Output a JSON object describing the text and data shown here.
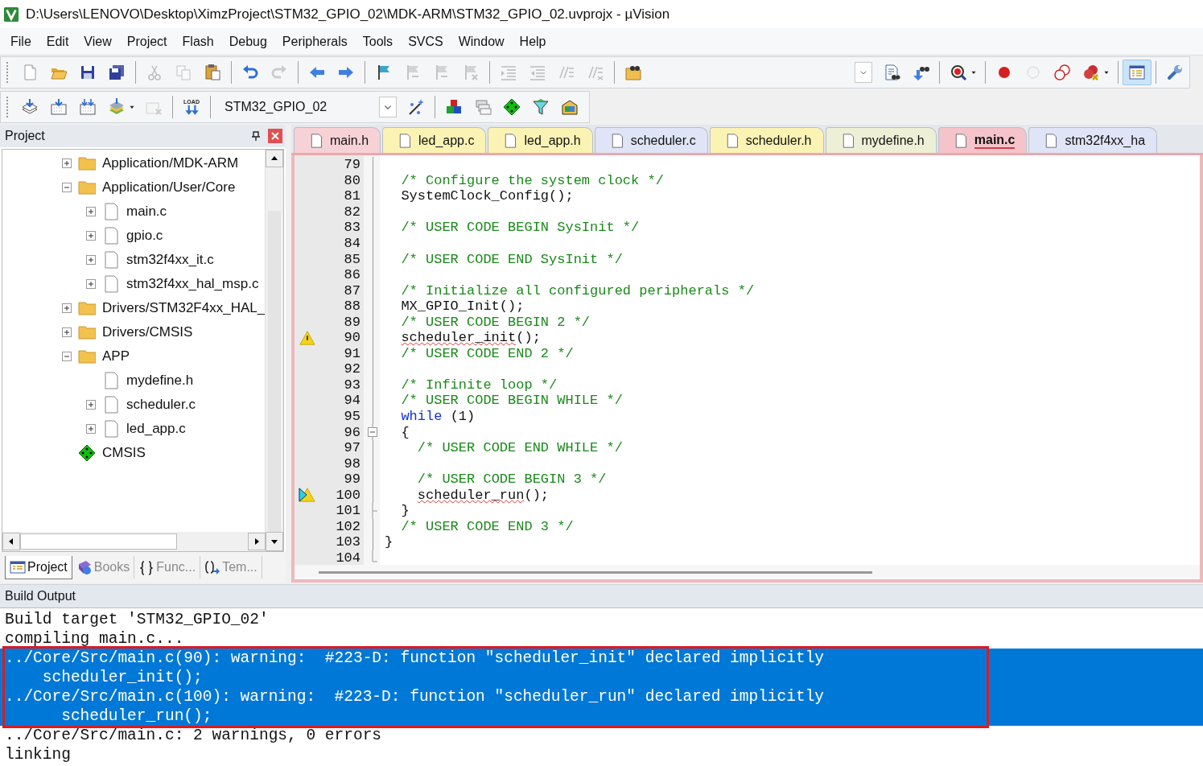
{
  "window": {
    "title": "D:\\Users\\LENOVO\\Desktop\\XimzProject\\STM32_GPIO_02\\MDK-ARM\\STM32_GPIO_02.uvprojx - µVision"
  },
  "menu": [
    "File",
    "Edit",
    "View",
    "Project",
    "Flash",
    "Debug",
    "Peripherals",
    "Tools",
    "SVCS",
    "Window",
    "Help"
  ],
  "toolbar_1": [
    {
      "kind": "new",
      "disabled": false,
      "pressed": false
    },
    {
      "kind": "open",
      "disabled": false,
      "pressed": false
    },
    {
      "kind": "save",
      "disabled": false,
      "pressed": false
    },
    {
      "kind": "save-all",
      "disabled": false,
      "pressed": false
    },
    {
      "kind": "separator"
    },
    {
      "kind": "cut",
      "disabled": true,
      "pressed": false
    },
    {
      "kind": "copy",
      "disabled": true,
      "pressed": false
    },
    {
      "kind": "paste",
      "disabled": false,
      "pressed": false
    },
    {
      "kind": "separator"
    },
    {
      "kind": "undo",
      "disabled": false,
      "pressed": false
    },
    {
      "kind": "redo",
      "disabled": true,
      "pressed": false
    },
    {
      "kind": "separator"
    },
    {
      "kind": "back",
      "disabled": false,
      "pressed": false
    },
    {
      "kind": "forward",
      "disabled": false,
      "pressed": false
    },
    {
      "kind": "separator"
    },
    {
      "kind": "bookmark",
      "disabled": false,
      "pressed": false
    },
    {
      "kind": "bookmark-prev",
      "disabled": true,
      "pressed": false
    },
    {
      "kind": "bookmark-next",
      "disabled": true,
      "pressed": false
    },
    {
      "kind": "bookmark-clear",
      "disabled": true,
      "pressed": false
    },
    {
      "kind": "separator"
    },
    {
      "kind": "indent",
      "disabled": true,
      "pressed": false
    },
    {
      "kind": "unindent",
      "disabled": true,
      "pressed": false
    },
    {
      "kind": "comment",
      "disabled": true,
      "pressed": false
    },
    {
      "kind": "uncomment",
      "disabled": true,
      "pressed": false
    },
    {
      "kind": "separator"
    },
    {
      "kind": "find-in-files",
      "disabled": false,
      "pressed": false
    },
    {
      "kind": "spacer"
    },
    {
      "kind": "find-combo"
    },
    {
      "kind": "find",
      "disabled": false,
      "pressed": false
    },
    {
      "kind": "incremental-find",
      "disabled": false,
      "pressed": false
    },
    {
      "kind": "separator"
    },
    {
      "kind": "debug",
      "disabled": false,
      "pressed": false
    },
    {
      "kind": "caret",
      "disabled": false,
      "pressed": false
    },
    {
      "kind": "separator"
    },
    {
      "kind": "breakpoint",
      "disabled": false,
      "pressed": false
    },
    {
      "kind": "breakpoint-disable",
      "disabled": true,
      "pressed": false
    },
    {
      "kind": "breakpoint-kill",
      "disabled": false,
      "pressed": false
    },
    {
      "kind": "breakpoint-kill-all",
      "disabled": false,
      "pressed": false
    },
    {
      "kind": "caret",
      "disabled": false,
      "pressed": false
    },
    {
      "kind": "separator"
    },
    {
      "kind": "window-layout",
      "disabled": false,
      "pressed": true
    },
    {
      "kind": "separator"
    },
    {
      "kind": "configure",
      "disabled": false,
      "pressed": false
    }
  ],
  "toolbar_2": [
    {
      "kind": "translate",
      "disabled": false,
      "pressed": false
    },
    {
      "kind": "build",
      "disabled": false,
      "pressed": false
    },
    {
      "kind": "rebuild",
      "disabled": false,
      "pressed": false
    },
    {
      "kind": "batch-build",
      "disabled": false,
      "pressed": false
    },
    {
      "kind": "caret",
      "disabled": false,
      "pressed": false
    },
    {
      "kind": "stop-build",
      "disabled": true,
      "pressed": false
    },
    {
      "kind": "separator"
    },
    {
      "kind": "load",
      "disabled": false,
      "pressed": false,
      "label": "LOAD"
    },
    {
      "kind": "separator"
    },
    {
      "kind": "target",
      "value": "STM32_GPIO_02"
    },
    {
      "kind": "options",
      "disabled": false,
      "pressed": false
    },
    {
      "kind": "separator"
    },
    {
      "kind": "manage",
      "disabled": false,
      "pressed": false
    },
    {
      "kind": "multi-project",
      "disabled": false,
      "pressed": false
    },
    {
      "kind": "run-time",
      "disabled": false,
      "pressed": false
    },
    {
      "kind": "select-packs",
      "disabled": false,
      "pressed": false
    },
    {
      "kind": "pack-installer",
      "disabled": false,
      "pressed": false
    }
  ],
  "project_panel": {
    "title": "Project",
    "tree": [
      {
        "label": "Application/MDK-ARM",
        "kind": "folder",
        "expanded": false
      },
      {
        "label": "Application/User/Core",
        "kind": "folder",
        "expanded": true,
        "children": [
          {
            "label": "main.c",
            "kind": "file",
            "expanded": false
          },
          {
            "label": "gpio.c",
            "kind": "file",
            "expanded": false
          },
          {
            "label": "stm32f4xx_it.c",
            "kind": "file",
            "expanded": false
          },
          {
            "label": "stm32f4xx_hal_msp.c",
            "kind": "file",
            "expanded": false
          }
        ]
      },
      {
        "label": "Drivers/STM32F4xx_HAL_",
        "kind": "folder",
        "expanded": false
      },
      {
        "label": "Drivers/CMSIS",
        "kind": "folder",
        "expanded": false
      },
      {
        "label": "APP",
        "kind": "folder",
        "expanded": true,
        "children": [
          {
            "label": "mydefine.h",
            "kind": "file"
          },
          {
            "label": "scheduler.c",
            "kind": "file",
            "expanded": false
          },
          {
            "label": "led_app.c",
            "kind": "file",
            "expanded": false
          }
        ]
      },
      {
        "label": "CMSIS",
        "kind": "component"
      }
    ],
    "tabs": [
      {
        "label": "Project",
        "kind": "project",
        "selected": true
      },
      {
        "label": "Books",
        "kind": "books",
        "selected": false
      },
      {
        "label": "Func...",
        "kind": "functions",
        "selected": false
      },
      {
        "label": "Tem...",
        "kind": "templates",
        "selected": false
      }
    ]
  },
  "editor": {
    "tabs": [
      {
        "label": "main.h",
        "color": "#f6d2d6",
        "selected": false
      },
      {
        "label": "led_app.c",
        "color": "#fbf3b4",
        "selected": false
      },
      {
        "label": "led_app.h",
        "color": "#fbf3b4",
        "selected": false
      },
      {
        "label": "scheduler.c",
        "color": "#dfe4f6",
        "selected": false
      },
      {
        "label": "scheduler.h",
        "color": "#fbf3b4",
        "selected": false
      },
      {
        "label": "mydefine.h",
        "color": "#eef0d6",
        "selected": false
      },
      {
        "label": "main.c",
        "color": "#f5c4ca",
        "selected": true
      },
      {
        "label": "stm32f4xx_ha",
        "color": "#dfe4f6",
        "selected": false
      }
    ],
    "lines": [
      {
        "number": "79",
        "kind": "line",
        "warning": false,
        "current": false
      },
      {
        "number": "80",
        "kind": "line",
        "warning": false,
        "current": false,
        "code": [
          {
            "kind": "comment",
            "text": "  /* Configure the system clock */"
          }
        ]
      },
      {
        "number": "81",
        "kind": "line",
        "warning": false,
        "current": false,
        "code": [
          {
            "kind": "plain",
            "text": "  SystemClock_Config();"
          }
        ]
      },
      {
        "number": "82",
        "kind": "line",
        "warning": false,
        "current": false
      },
      {
        "number": "83",
        "kind": "line",
        "warning": false,
        "current": false,
        "code": [
          {
            "kind": "comment",
            "text": "  /* USER CODE BEGIN SysInit */"
          }
        ]
      },
      {
        "number": "84",
        "kind": "line",
        "warning": false,
        "current": false
      },
      {
        "number": "85",
        "kind": "line",
        "warning": false,
        "current": false,
        "code": [
          {
            "kind": "comment",
            "text": "  /* USER CODE END SysInit */"
          }
        ]
      },
      {
        "number": "86",
        "kind": "line",
        "warning": false,
        "current": false
      },
      {
        "number": "87",
        "kind": "line",
        "warning": false,
        "current": false,
        "code": [
          {
            "kind": "comment",
            "text": "  /* Initialize all configured peripherals */"
          }
        ]
      },
      {
        "number": "88",
        "kind": "line",
        "warning": false,
        "current": false,
        "code": [
          {
            "kind": "plain",
            "text": "  MX_GPIO_Init();"
          }
        ]
      },
      {
        "number": "89",
        "kind": "line",
        "warning": false,
        "current": false,
        "code": [
          {
            "kind": "comment",
            "text": "  /* USER CODE BEGIN 2 */"
          }
        ]
      },
      {
        "number": "90",
        "kind": "line",
        "warning": true,
        "current": false,
        "code": [
          {
            "kind": "squiggle",
            "text": "  scheduler_init"
          },
          {
            "kind": "plain",
            "text": "();"
          }
        ]
      },
      {
        "number": "91",
        "kind": "line",
        "warning": false,
        "current": false,
        "code": [
          {
            "kind": "comment",
            "text": "  /* USER CODE END 2 */"
          }
        ]
      },
      {
        "number": "92",
        "kind": "line",
        "warning": false,
        "current": false
      },
      {
        "number": "93",
        "kind": "line",
        "warning": false,
        "current": false,
        "code": [
          {
            "kind": "comment",
            "text": "  /* Infinite loop */"
          }
        ]
      },
      {
        "number": "94",
        "kind": "line",
        "warning": false,
        "current": false,
        "code": [
          {
            "kind": "comment",
            "text": "  /* USER CODE BEGIN WHILE */"
          }
        ]
      },
      {
        "number": "95",
        "kind": "line",
        "warning": false,
        "current": false,
        "code": [
          {
            "kind": "keyword",
            "text": "  while"
          },
          {
            "kind": "plain",
            "text": " (1)"
          }
        ]
      },
      {
        "number": "96",
        "kind": "fold-start",
        "warning": false,
        "current": false,
        "code": [
          {
            "kind": "plain",
            "text": "  {"
          }
        ]
      },
      {
        "number": "97",
        "kind": "line",
        "warning": false,
        "current": false,
        "code": [
          {
            "kind": "comment",
            "text": "    /* USER CODE END WHILE */"
          }
        ]
      },
      {
        "number": "98",
        "kind": "line",
        "warning": false,
        "current": false
      },
      {
        "number": "99",
        "kind": "line",
        "warning": false,
        "current": false,
        "code": [
          {
            "kind": "comment",
            "text": "    /* USER CODE BEGIN 3 */"
          }
        ]
      },
      {
        "number": "100",
        "kind": "line",
        "warning": true,
        "current": true,
        "code": [
          {
            "kind": "squiggle",
            "text": "    scheduler_run"
          },
          {
            "kind": "plain",
            "text": "();"
          }
        ]
      },
      {
        "number": "101",
        "kind": "fold-tick",
        "warning": false,
        "current": false,
        "code": [
          {
            "kind": "plain",
            "text": "  }"
          }
        ]
      },
      {
        "number": "102",
        "kind": "line",
        "warning": false,
        "current": false,
        "code": [
          {
            "kind": "comment",
            "text": "  /* USER CODE END 3 */"
          }
        ]
      },
      {
        "number": "103",
        "kind": "line",
        "warning": false,
        "current": false,
        "code": [
          {
            "kind": "plain",
            "text": "}"
          }
        ]
      },
      {
        "number": "104",
        "kind": "fold-end",
        "warning": false,
        "current": false
      }
    ]
  },
  "build_output": {
    "title": "Build Output",
    "frame_around_selection": true,
    "lines": [
      {
        "text": "Build target 'STM32_GPIO_02'",
        "selected": false
      },
      {
        "text": "compiling main.c...",
        "selected": false
      },
      {
        "text": "../Core/Src/main.c(90): warning:  #223-D: function \"scheduler_init\" declared implicitly",
        "selected": true
      },
      {
        "text": "    scheduler_init();",
        "selected": true
      },
      {
        "text": "../Core/Src/main.c(100): warning:  #223-D: function \"scheduler_run\" declared implicitly",
        "selected": true
      },
      {
        "text": "      scheduler_run();",
        "selected": true
      },
      {
        "text": "../Core/Src/main.c: 2 warnings, 0 errors",
        "selected": false
      },
      {
        "text": "linking",
        "selected": false
      }
    ]
  }
}
